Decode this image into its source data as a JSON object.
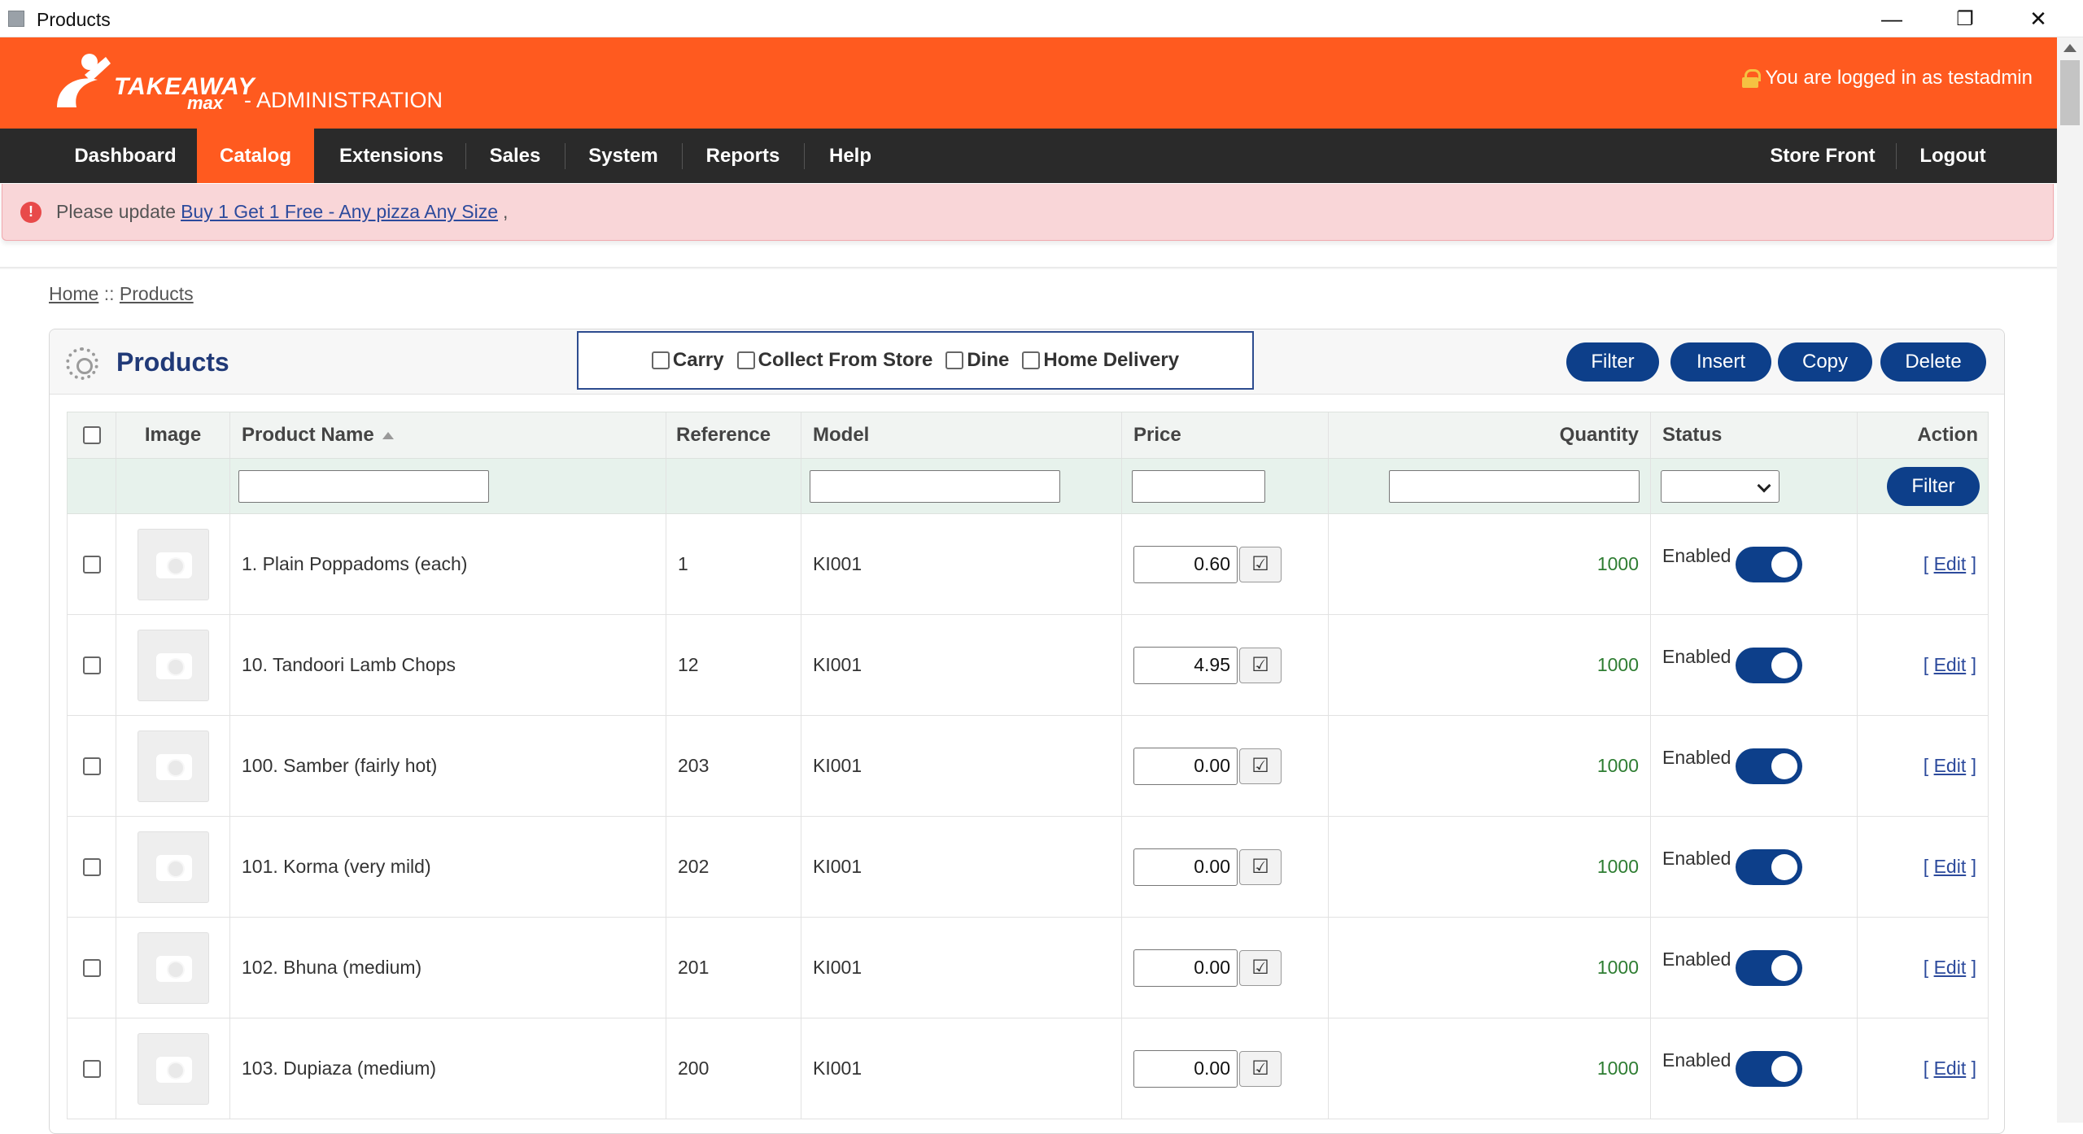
{
  "window": {
    "title": "Products",
    "minimize_icon": "—",
    "restore_icon": "❐",
    "close_icon": "✕"
  },
  "header": {
    "logo_brand": "TAKEAWAY",
    "logo_sub": "max",
    "admin_label": "- ADMINISTRATION",
    "login_text": "You are logged in as testadmin"
  },
  "nav": {
    "items": [
      "Dashboard",
      "Catalog",
      "Extensions",
      "Sales",
      "System",
      "Reports",
      "Help"
    ],
    "active": "Catalog",
    "right_items": [
      "Store Front",
      "Logout"
    ]
  },
  "alert": {
    "prefix": "Please update",
    "link": "Buy 1 Get 1 Free - Any pizza Any Size",
    "suffix": ","
  },
  "breadcrumb": {
    "home": "Home",
    "sep": "::",
    "current": "Products"
  },
  "panel": {
    "title": "Products",
    "order_types": [
      "Carry",
      "Collect From Store",
      "Dine",
      "Home Delivery"
    ],
    "buttons": {
      "filter": "Filter",
      "insert": "Insert",
      "copy": "Copy",
      "delete": "Delete"
    }
  },
  "table": {
    "columns": {
      "image": "Image",
      "name": "Product Name",
      "reference": "Reference",
      "model": "Model",
      "price": "Price",
      "quantity": "Quantity",
      "status": "Status",
      "action": "Action"
    },
    "filter_button": "Filter",
    "save_icon": "☑",
    "edit_open": "[",
    "edit_label": "Edit",
    "edit_close": "]",
    "rows": [
      {
        "name": "1. Plain Poppadoms (each)",
        "reference": "1",
        "model": "KI001",
        "price": "0.60",
        "quantity": "1000",
        "status": "Enabled"
      },
      {
        "name": "10. Tandoori Lamb Chops",
        "reference": "12",
        "model": "KI001",
        "price": "4.95",
        "quantity": "1000",
        "status": "Enabled"
      },
      {
        "name": "100. Samber (fairly hot)",
        "reference": "203",
        "model": "KI001",
        "price": "0.00",
        "quantity": "1000",
        "status": "Enabled"
      },
      {
        "name": "101. Korma (very mild)",
        "reference": "202",
        "model": "KI001",
        "price": "0.00",
        "quantity": "1000",
        "status": "Enabled"
      },
      {
        "name": "102. Bhuna (medium)",
        "reference": "201",
        "model": "KI001",
        "price": "0.00",
        "quantity": "1000",
        "status": "Enabled"
      },
      {
        "name": "103. Dupiaza (medium)",
        "reference": "200",
        "model": "KI001",
        "price": "0.00",
        "quantity": "1000",
        "status": "Enabled"
      }
    ]
  },
  "colors": {
    "brand_orange": "#ff5a1f",
    "nav_dark": "#2a2a2a",
    "button_blue": "#0d3f8a",
    "quantity_green": "#2e7d32",
    "alert_pink": "#f9d6d8"
  }
}
